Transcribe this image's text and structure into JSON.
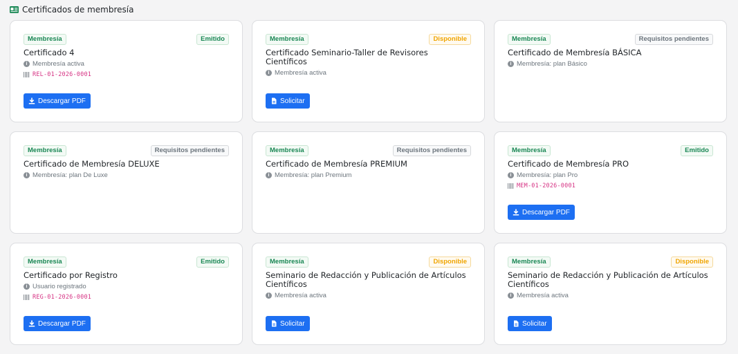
{
  "section": {
    "title": "Certificados de membresía",
    "icon": "id-card-icon"
  },
  "colors": {
    "accent": "#1d6ff2",
    "success": "#198754",
    "warning": "#f0a500",
    "muted": "#6c757d",
    "code": "#d63384"
  },
  "cards": [
    {
      "badge": "Membresía",
      "status": "Emitido",
      "title": "Certificado 4",
      "meta": "Membresía activa",
      "code": "REL-01-2026-0001",
      "button": "Descargar PDF",
      "button_icon": "download-icon"
    },
    {
      "badge": "Membresía",
      "status": "Disponible",
      "title": "Certificado Seminario-Taller de Revisores Científicos",
      "meta": "Membresía activa",
      "button": "Solicitar",
      "button_icon": "file-icon"
    },
    {
      "badge": "Membresía",
      "status": "Requisitos pendientes",
      "title": "Certificado de Membresía BÁSICA",
      "meta": "Membresía: plan Básico"
    },
    {
      "badge": "Membresía",
      "status": "Requisitos pendientes",
      "title": "Certificado de Membresía DELUXE",
      "meta": "Membresía: plan De Luxe"
    },
    {
      "badge": "Membresía",
      "status": "Requisitos pendientes",
      "title": "Certificado de Membresía PREMIUM",
      "meta": "Membresía: plan Premium"
    },
    {
      "badge": "Membresía",
      "status": "Emitido",
      "title": "Certificado de Membresía PRO",
      "meta": "Membresía: plan Pro",
      "code": "MEM-01-2026-0001",
      "button": "Descargar PDF",
      "button_icon": "download-icon"
    },
    {
      "badge": "Membresía",
      "status": "Emitido",
      "title": "Certificado por Registro",
      "meta": "Usuario registrado",
      "code": "REG-01-2026-0001",
      "button": "Descargar PDF",
      "button_icon": "download-icon"
    },
    {
      "badge": "Membresía",
      "status": "Disponible",
      "title": "Seminario de Redacción y Publicación de Artículos Científicos",
      "meta": "Membresía activa",
      "button": "Solicitar",
      "button_icon": "file-icon"
    },
    {
      "badge": "Membresía",
      "status": "Disponible",
      "title": "Seminario de Redacción y Publicación de Artículos Científicos",
      "meta": "Membresía activa",
      "button": "Solicitar",
      "button_icon": "file-icon"
    }
  ]
}
